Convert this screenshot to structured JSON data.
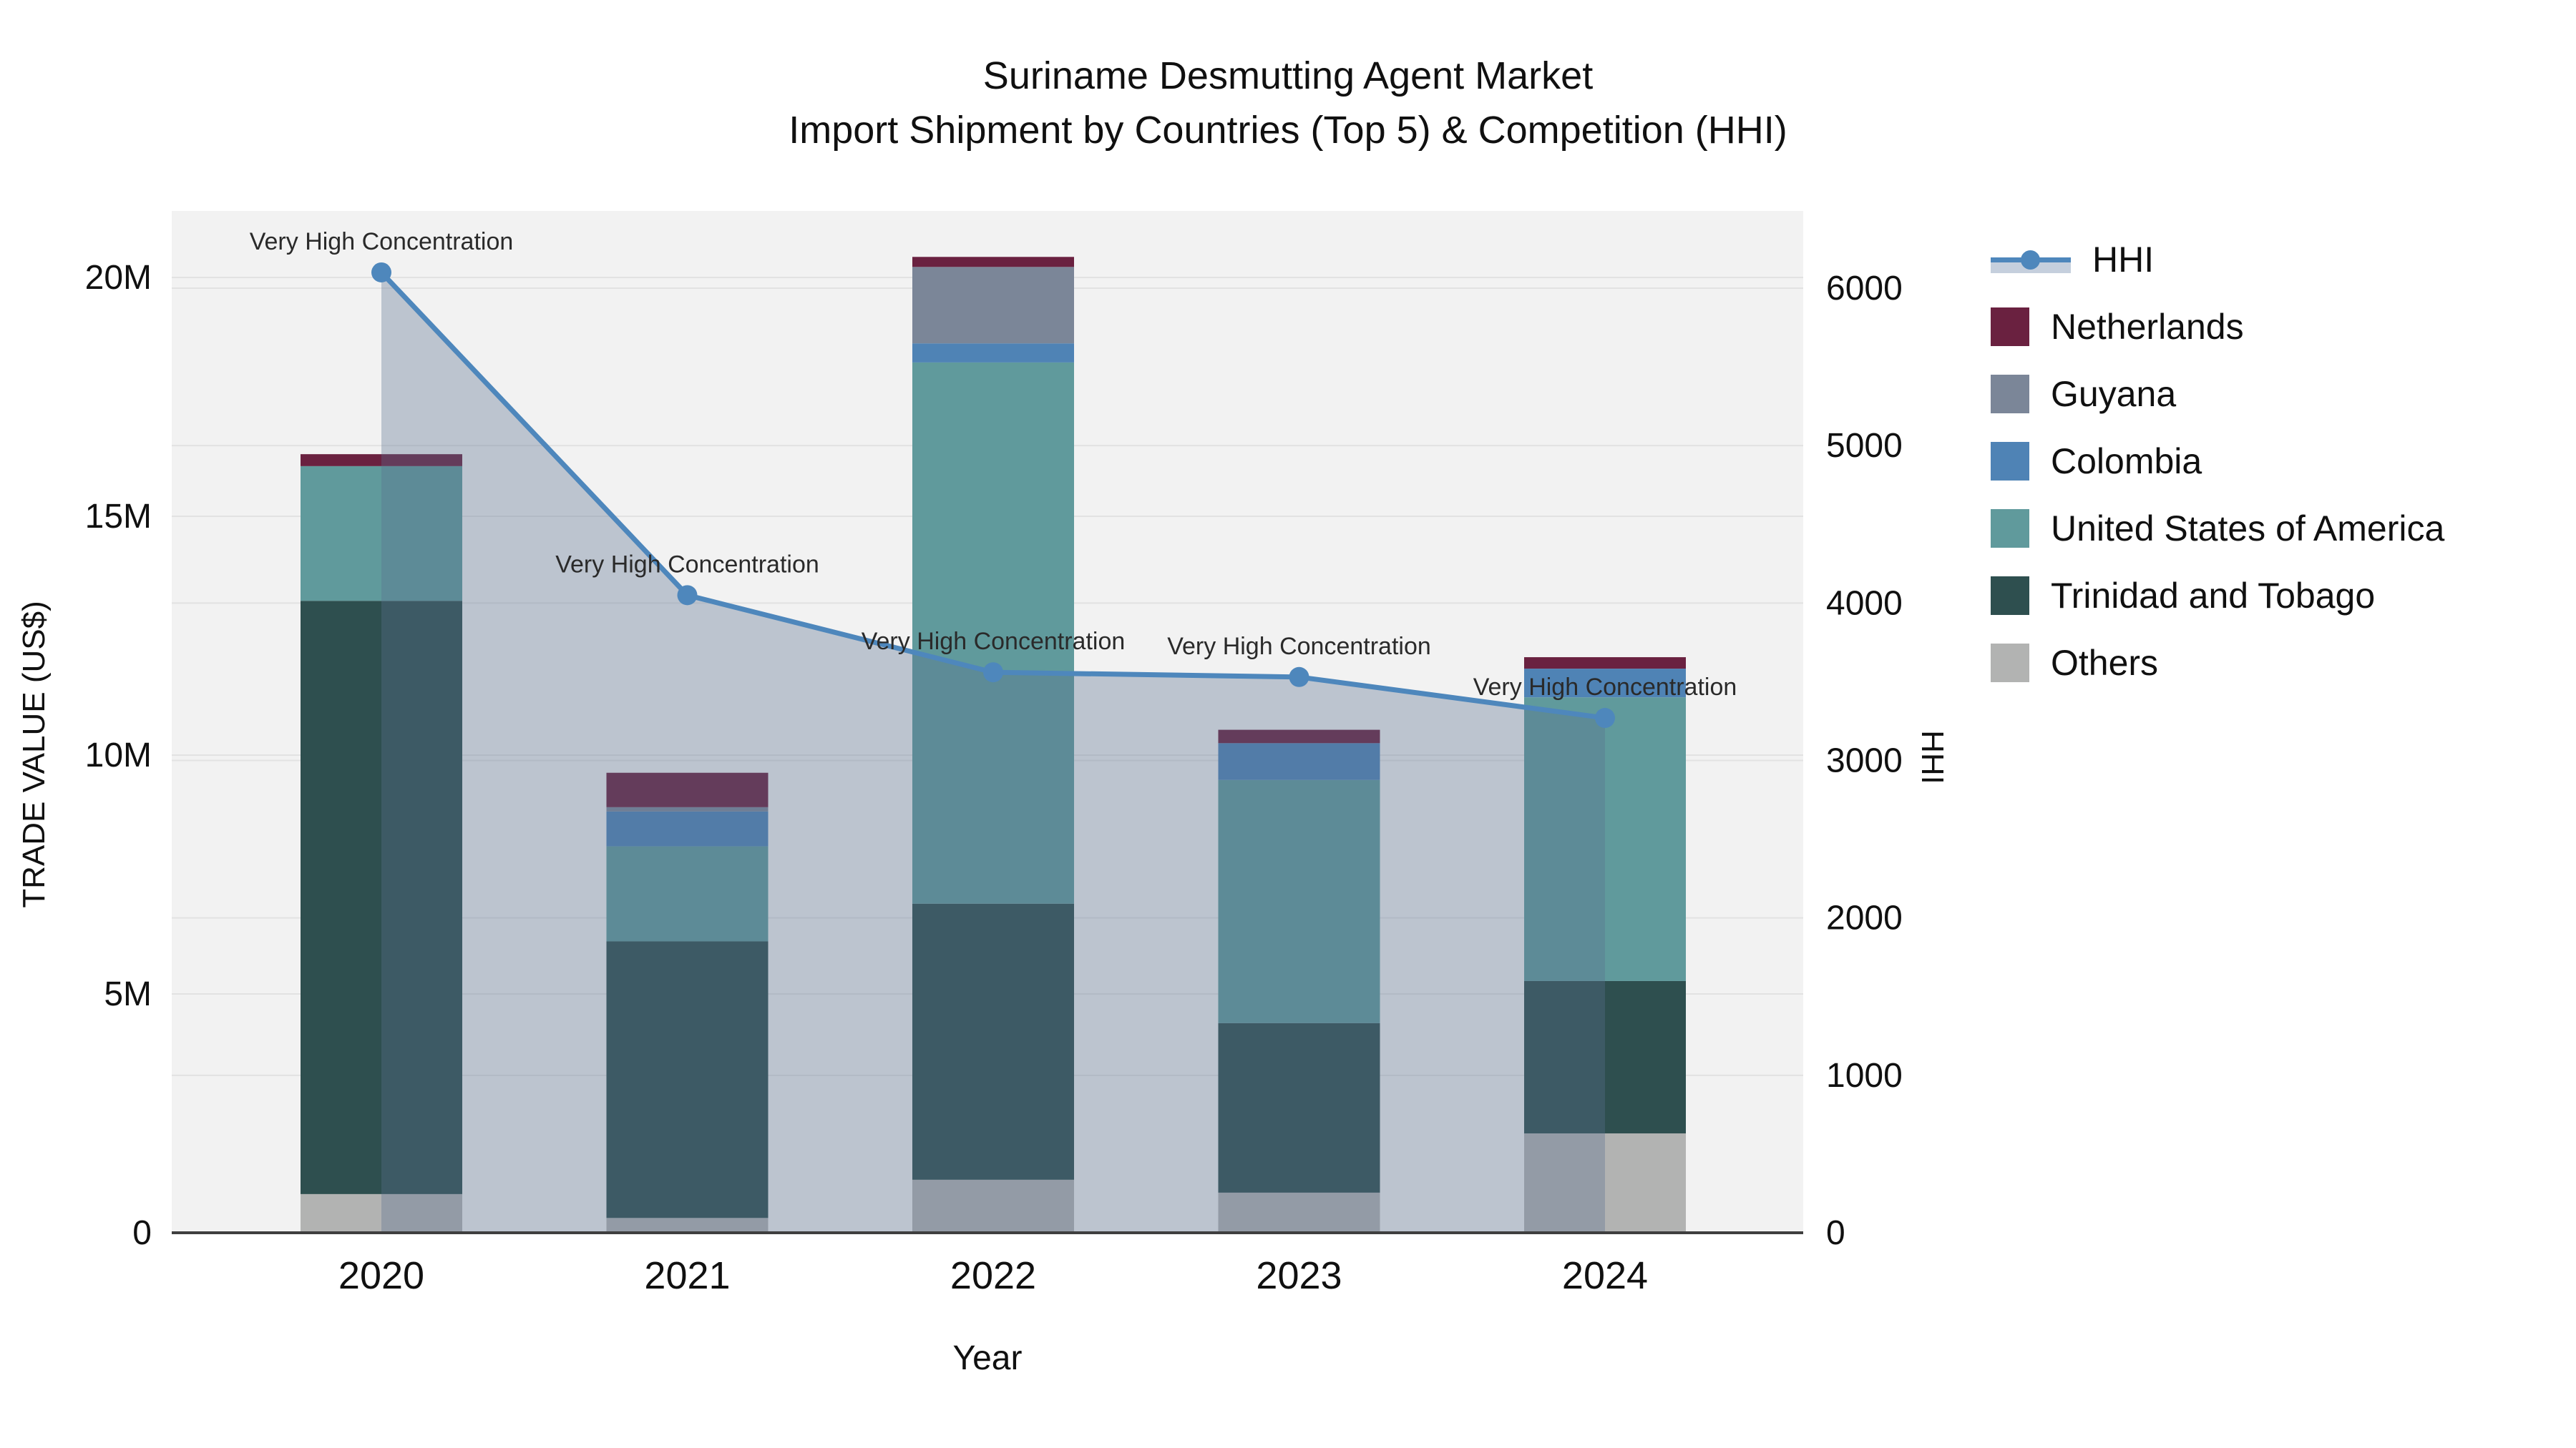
{
  "title": {
    "line1": "Suriname Desmutting Agent Market",
    "line2": "Import Shipment by Countries (Top 5) & Competition (HHI)"
  },
  "axes": {
    "x_title": "Year",
    "y_left_title": "TRADE VALUE (US$)",
    "y_right_title": "HHI",
    "y_left_ticks": [
      {
        "value": 0,
        "label": "0"
      },
      {
        "value": 5,
        "label": "5M"
      },
      {
        "value": 10,
        "label": "10M"
      },
      {
        "value": 15,
        "label": "15M"
      },
      {
        "value": 20,
        "label": "20M"
      }
    ],
    "y_right_ticks": [
      {
        "value": 0,
        "label": "0"
      },
      {
        "value": 1000,
        "label": "1000"
      },
      {
        "value": 2000,
        "label": "2000"
      },
      {
        "value": 3000,
        "label": "3000"
      },
      {
        "value": 4000,
        "label": "4000"
      },
      {
        "value": 5000,
        "label": "5000"
      },
      {
        "value": 6000,
        "label": "6000"
      }
    ]
  },
  "legend": {
    "items": [
      {
        "label": "HHI",
        "type": "line",
        "color": "#4e87bc"
      },
      {
        "label": "Netherlands",
        "type": "bar",
        "color": "#6a2140"
      },
      {
        "label": "Guyana",
        "type": "bar",
        "color": "#7b8698"
      },
      {
        "label": "Colombia",
        "type": "bar",
        "color": "#4f83b5"
      },
      {
        "label": "United States of America",
        "type": "bar",
        "color": "#609a9c"
      },
      {
        "label": "Trinidad and Tobago",
        "type": "bar",
        "color": "#2e4f4f"
      },
      {
        "label": "Others",
        "type": "bar",
        "color": "#b2b3b2"
      }
    ]
  },
  "chart_data": {
    "type": "combo_stacked_bar_line",
    "categories": [
      "2020",
      "2021",
      "2022",
      "2023",
      "2024"
    ],
    "bar_unit": "million US$",
    "ylabel_left": "TRADE VALUE (US$)",
    "ylabel_right": "HHI",
    "ylim_left_millions": [
      0,
      20
    ],
    "ylim_right": [
      0,
      6000
    ],
    "grid": true,
    "legend_position": "right",
    "stack_order_bottom_to_top": [
      "Others",
      "Trinidad and Tobago",
      "United States of America",
      "Colombia",
      "Guyana",
      "Netherlands"
    ],
    "series": [
      {
        "name": "Netherlands",
        "color": "#6a2140",
        "values": [
          0.25,
          0.72,
          0.21,
          0.28,
          0.24
        ]
      },
      {
        "name": "Guyana",
        "color": "#7b8698",
        "values": [
          0.0,
          0.09,
          1.6,
          0.0,
          0.0
        ]
      },
      {
        "name": "Colombia",
        "color": "#4f83b5",
        "values": [
          0.0,
          0.73,
          0.4,
          0.77,
          0.6
        ]
      },
      {
        "name": "United States of America",
        "color": "#609a9c",
        "values": [
          2.82,
          1.99,
          11.33,
          5.09,
          5.94
        ]
      },
      {
        "name": "Trinidad and Tobago",
        "color": "#2e4f4f",
        "values": [
          12.42,
          5.79,
          5.78,
          3.55,
          3.19
        ]
      },
      {
        "name": "Others",
        "color": "#b2b3b2",
        "values": [
          0.81,
          0.31,
          1.11,
          0.84,
          2.08
        ]
      }
    ],
    "bar_totals_millions": [
      16.3,
      9.63,
      20.43,
      10.53,
      12.05
    ],
    "line_series": {
      "name": "HHI",
      "color": "#4e87bc",
      "area_fill": "rgba(90,112,144,0.35)",
      "values": [
        6100,
        4050,
        3560,
        3530,
        3270
      ]
    },
    "annotations": [
      {
        "text": "Very High Concentration",
        "year": "2020"
      },
      {
        "text": "Very High Concentration",
        "year": "2021"
      },
      {
        "text": "Very High Concentration",
        "year": "2022"
      },
      {
        "text": "Very High Concentration",
        "year": "2023"
      },
      {
        "text": "Very High Concentration",
        "year": "2024"
      }
    ]
  },
  "colors": {
    "plot_bg": "#f2f2f2",
    "grid": "#e2e2e2",
    "axis_line": "#3f3f3f",
    "text": "#101010",
    "annotation_text": "#2a2a2a"
  }
}
